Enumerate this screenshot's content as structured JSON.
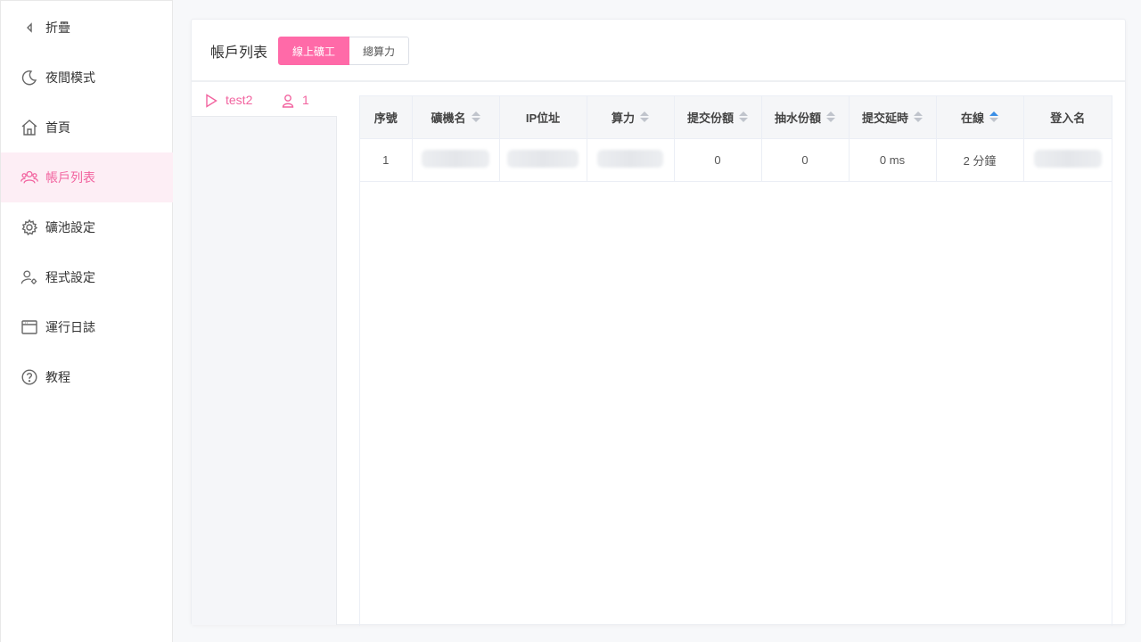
{
  "sidebar": {
    "items": [
      {
        "label": "折疊",
        "icon": "chevron-left-icon"
      },
      {
        "label": "夜間模式",
        "icon": "moon-icon"
      },
      {
        "label": "首頁",
        "icon": "home-icon"
      },
      {
        "label": "帳戶列表",
        "icon": "users-icon",
        "active": true
      },
      {
        "label": "礦池設定",
        "icon": "gear-icon"
      },
      {
        "label": "程式設定",
        "icon": "user-gear-icon"
      },
      {
        "label": "運行日誌",
        "icon": "window-icon"
      },
      {
        "label": "教程",
        "icon": "question-icon"
      }
    ]
  },
  "header": {
    "title": "帳戶列表",
    "tabs": [
      {
        "label": "線上礦工",
        "active": true
      },
      {
        "label": "總算力",
        "active": false
      }
    ]
  },
  "account": {
    "name": "test2",
    "count": "1"
  },
  "table": {
    "columns": [
      "序號",
      "礦機名",
      "IP位址",
      "算力",
      "提交份額",
      "抽水份額",
      "提交延時",
      "在線",
      "登入名"
    ],
    "rows": [
      {
        "index": "1",
        "miner": "",
        "ip": "",
        "hashrate": "",
        "shares": "0",
        "fee_shares": "0",
        "latency": "0 ms",
        "online": "2 分鐘",
        "login": ""
      }
    ]
  },
  "colors": {
    "accent": "#ff6aa8",
    "accent_text": "#f2639f",
    "active_bg": "#fdeef5",
    "sort_active": "#3a8ee6"
  }
}
